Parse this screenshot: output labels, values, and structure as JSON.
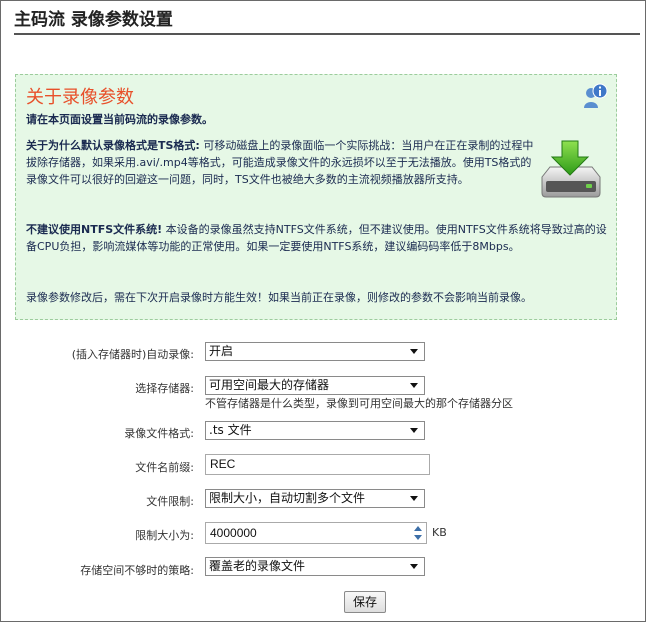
{
  "page": {
    "title": "主码流 录像参数设置"
  },
  "info": {
    "heading": "关于录像参数",
    "subtitle": "请在本页面设置当前码流的录像参数。",
    "para1_bold": "关于为什么默认录像格式是TS格式:",
    "para1_text": " 可移动磁盘上的录像面临一个实际挑战：当用户在正在录制的过程中拔除存储器，如果采用.avi/.mp4等格式，可能造成录像文件的永远损坏以至于无法播放。使用TS格式的录像文件可以很好的回避这一问题，同时，TS文件也被绝大多数的主流视频播放器所支持。",
    "para2_bold": "不建议使用NTFS文件系统!",
    "para2_text": " 本设备的录像虽然支持NTFS文件系统，但不建议使用。使用NTFS文件系统将导致过高的设备CPU负担，影响流媒体等功能的正常使用。如果一定要使用NTFS系统，建议编码码率低于8Mbps。",
    "para3": "录像参数修改后，需在下次开启录像时方能生效！如果当前正在录像，则修改的参数不会影响当前录像。",
    "help_icon": "help-info-icon",
    "download_icon": "download-drive-icon"
  },
  "form": {
    "auto_record": {
      "label": "(插入存储器时)自动录像:",
      "value": "开启"
    },
    "storage": {
      "label": "选择存储器:",
      "value": "可用空间最大的存储器",
      "hint": "不管存储器是什么类型，录像到可用空间最大的那个存储器分区"
    },
    "format": {
      "label": "录像文件格式:",
      "value": ".ts 文件"
    },
    "prefix": {
      "label": "文件名前缀:",
      "value": "REC"
    },
    "limit": {
      "label": "文件限制:",
      "value": "限制大小，自动切割多个文件"
    },
    "limit_size": {
      "label": "限制大小为:",
      "value": "4000000",
      "unit": "KB"
    },
    "policy": {
      "label": "存储空间不够时的策略:",
      "value": "覆盖老的录像文件"
    },
    "save_label": "保存"
  },
  "colors": {
    "heading": "#e8502a",
    "info_bg": "#e6f8e6",
    "info_border": "#9ccc9c",
    "text_dark": "#1a2a50"
  }
}
